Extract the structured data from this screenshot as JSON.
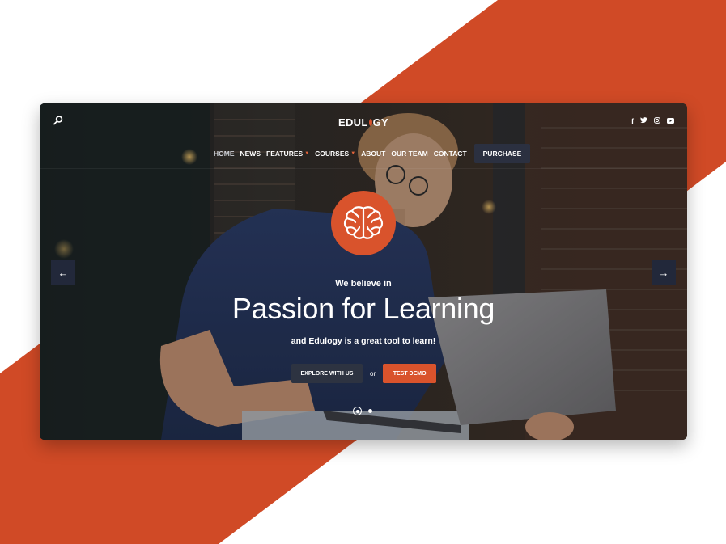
{
  "colors": {
    "accent": "#d9532c",
    "dark_button": "#2d3341"
  },
  "header": {
    "logo_left": "EDUL",
    "logo_right": "GY",
    "social": [
      "f",
      "🐦",
      "◎",
      "▶"
    ]
  },
  "nav": {
    "items": [
      {
        "label": "HOME"
      },
      {
        "label": "NEWS"
      },
      {
        "label": "FEATURES"
      },
      {
        "label": "COURSES"
      },
      {
        "label": "ABOUT"
      },
      {
        "label": "OUR TEAM"
      },
      {
        "label": "CONTACT"
      }
    ],
    "purchase": "PURCHASE"
  },
  "hero": {
    "tagline": "We believe in",
    "headline": "Passion for Learning",
    "subline": "and Edulogy is a great tool to learn!",
    "explore": "EXPLORE WITH US",
    "or": "or",
    "demo": "TEST DEMO",
    "prev_arrow": "←",
    "next_arrow": "→"
  },
  "slider": {
    "current": 1,
    "total": 2
  }
}
